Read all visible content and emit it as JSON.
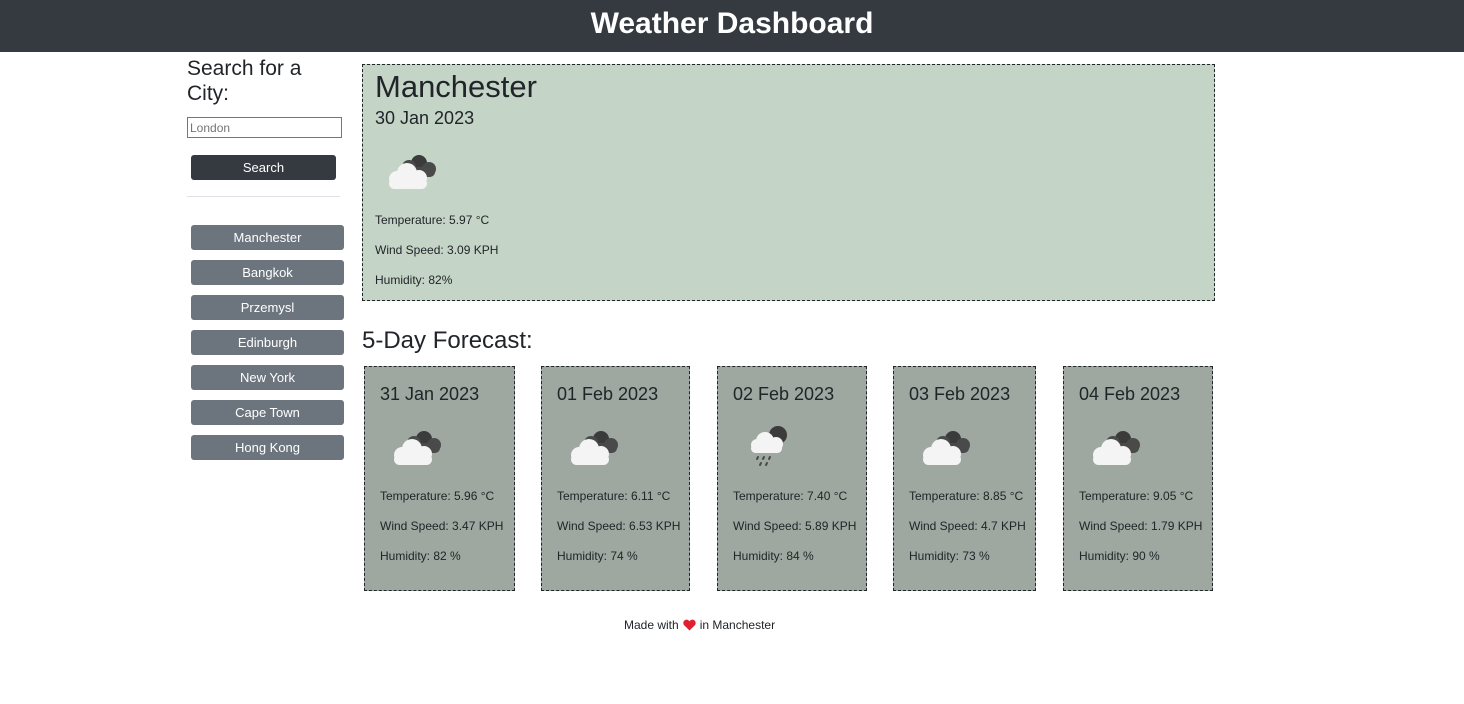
{
  "header": {
    "title": "Weather Dashboard"
  },
  "search": {
    "title": "Search for a City:",
    "placeholder": "London",
    "button_label": "Search"
  },
  "history": [
    {
      "label": "Manchester"
    },
    {
      "label": "Bangkok"
    },
    {
      "label": "Przemysl"
    },
    {
      "label": "Edinburgh"
    },
    {
      "label": "New York"
    },
    {
      "label": "Cape Town"
    },
    {
      "label": "Hong Kong"
    }
  ],
  "current": {
    "city": "Manchester",
    "date": "30 Jan 2023",
    "icon": "cloudy-icon",
    "temperature": "Temperature: 5.97 °C",
    "wind": "Wind Speed: 3.09 KPH",
    "humidity": "Humidity: 82%"
  },
  "forecast": {
    "title": "5-Day Forecast:",
    "days": [
      {
        "date": "31 Jan 2023",
        "icon": "cloudy-icon",
        "temperature": "Temperature: 5.96 °C",
        "wind": "Wind Speed: 3.47 KPH",
        "humidity": "Humidity: 82 %"
      },
      {
        "date": "01 Feb 2023",
        "icon": "cloudy-icon",
        "temperature": "Temperature: 6.11 °C",
        "wind": "Wind Speed: 6.53 KPH",
        "humidity": "Humidity: 74 %"
      },
      {
        "date": "02 Feb 2023",
        "icon": "rain-cloud-icon",
        "temperature": "Temperature: 7.40 °C",
        "wind": "Wind Speed: 5.89 KPH",
        "humidity": "Humidity: 84 %"
      },
      {
        "date": "03 Feb 2023",
        "icon": "cloudy-icon",
        "temperature": "Temperature: 8.85 °C",
        "wind": "Wind Speed: 4.7 KPH",
        "humidity": "Humidity: 73 %"
      },
      {
        "date": "04 Feb 2023",
        "icon": "cloudy-icon",
        "temperature": "Temperature: 9.05 °C",
        "wind": "Wind Speed: 1.79 KPH",
        "humidity": "Humidity: 90 %"
      }
    ]
  },
  "footer": {
    "prefix": "Made with",
    "icon": "heart-icon",
    "suffix": "in Manchester"
  },
  "colors": {
    "header_bg": "#343a40",
    "current_bg": "#c4d4c6",
    "card_bg": "#9ea7a0",
    "city_button_bg": "#6c757d",
    "heart": "#e0202f"
  }
}
